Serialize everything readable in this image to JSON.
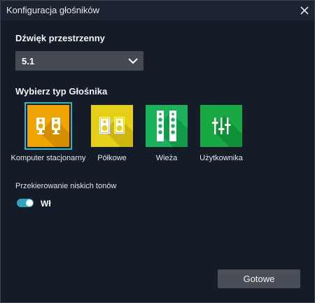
{
  "window": {
    "title": "Konfiguracja głośników"
  },
  "surround": {
    "label": "Dźwięk przestrzenny",
    "selected": "5.1"
  },
  "speaker_type": {
    "label": "Wybierz typ Głośnika",
    "options": [
      {
        "label": "Komputer stacjonarny",
        "color": "#f0a400",
        "icon": "desktop-speakers-icon",
        "selected": true
      },
      {
        "label": "Półkowe",
        "color": "#e6cf1a",
        "icon": "bookshelf-speakers-icon",
        "selected": false
      },
      {
        "label": "Wieża",
        "color": "#19b25a",
        "icon": "tower-speakers-icon",
        "selected": false
      },
      {
        "label": "Użytkownika",
        "color": "#18a944",
        "icon": "custom-equalizer-icon",
        "selected": false
      }
    ]
  },
  "bass_redirect": {
    "label": "Przekierowanie niskich tonów",
    "state_label": "Wł",
    "on": true,
    "accent": "#2aa6be"
  },
  "done_button": {
    "label": "Gotowe"
  }
}
